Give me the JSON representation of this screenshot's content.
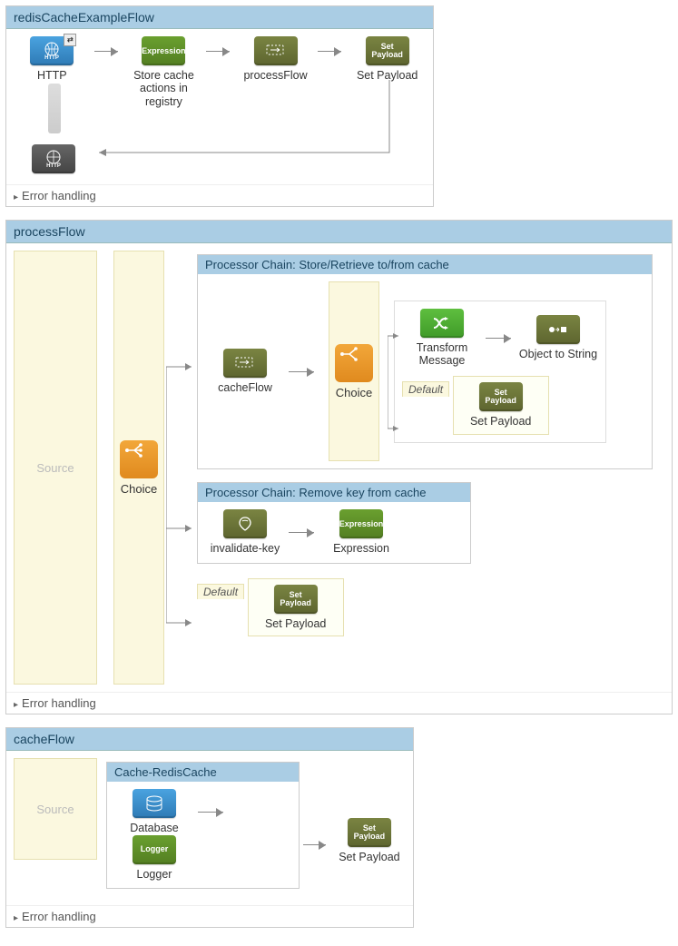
{
  "flow1": {
    "title": "redisCacheExampleFlow",
    "error": "Error handling",
    "nodes": {
      "http_in": "HTTP",
      "expr": "Store cache actions in registry",
      "proc": "processFlow",
      "setp": "Set Payload",
      "http_out": ""
    },
    "badges": {
      "expr": "Expression",
      "set": "Set\nPayload"
    }
  },
  "flow2": {
    "title": "processFlow",
    "error": "Error handling",
    "source": "Source",
    "choice": "Choice",
    "group1": {
      "title": "Processor Chain: Store/Retrieve to/from cache",
      "cacheflow": "cacheFlow",
      "choice": "Choice",
      "transform": "Transform Message",
      "o2s": "Object to String",
      "default": "Default",
      "setp": "Set Payload"
    },
    "group2": {
      "title": "Processor Chain: Remove key from cache",
      "inval": "invalidate-key",
      "expr": "Expression"
    },
    "default": "Default",
    "setp": "Set Payload",
    "badges": {
      "expr": "Expression",
      "set": "Set\nPayload"
    }
  },
  "flow3": {
    "title": "cacheFlow",
    "error": "Error handling",
    "source": "Source",
    "group": {
      "title": "Cache-RedisCache",
      "db": "Database",
      "log": "Logger"
    },
    "setp": "Set Payload",
    "badges": {
      "logger": "Logger",
      "set": "Set\nPayload"
    }
  },
  "icons": {
    "http": "HTTP"
  }
}
